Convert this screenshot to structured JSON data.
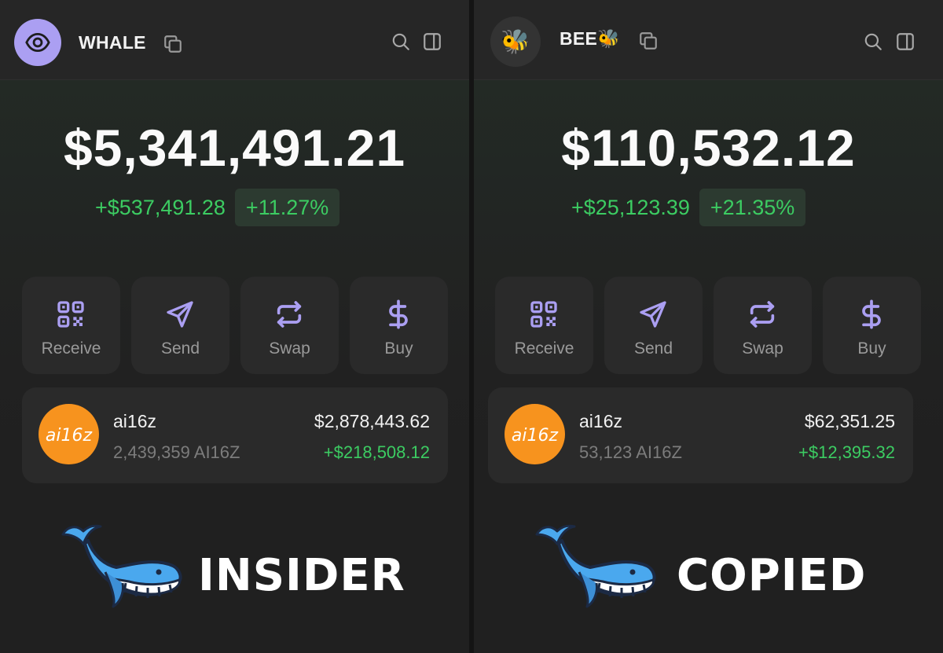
{
  "panels": [
    {
      "account_name": "WHALE",
      "avatar_icon": "eye-icon",
      "balance": "$5,341,491.21",
      "change_abs": "+$537,491.28",
      "change_pct": "+11.27%",
      "actions": [
        {
          "label": "Receive",
          "icon": "qr-code-icon"
        },
        {
          "label": "Send",
          "icon": "send-arrow-icon"
        },
        {
          "label": "Swap",
          "icon": "swap-arrows-icon"
        },
        {
          "label": "Buy",
          "icon": "dollar-icon"
        }
      ],
      "token": {
        "name": "ai16z",
        "quantity": "2,439,359 AI16Z",
        "value": "$2,878,443.62",
        "pnl": "+$218,508.12",
        "logo_text": "ai16z"
      },
      "caption": "INSIDER"
    },
    {
      "account_name": "BEE🐝",
      "avatar_icon": "🐝",
      "balance": "$110,532.12",
      "change_abs": "+$25,123.39",
      "change_pct": "+21.35%",
      "actions": [
        {
          "label": "Receive",
          "icon": "qr-code-icon"
        },
        {
          "label": "Send",
          "icon": "send-arrow-icon"
        },
        {
          "label": "Swap",
          "icon": "swap-arrows-icon"
        },
        {
          "label": "Buy",
          "icon": "dollar-icon"
        }
      ],
      "token": {
        "name": "ai16z",
        "quantity": "53,123 AI16Z",
        "value": "$62,351.25",
        "pnl": "+$12,395.32",
        "logo_text": "ai16z"
      },
      "caption": "COPIED"
    }
  ],
  "colors": {
    "accent": "#ab9ff2",
    "positive": "#3ccc62",
    "card": "#2a2a2a",
    "background": "#202020",
    "token_logo": "#f7931e"
  }
}
